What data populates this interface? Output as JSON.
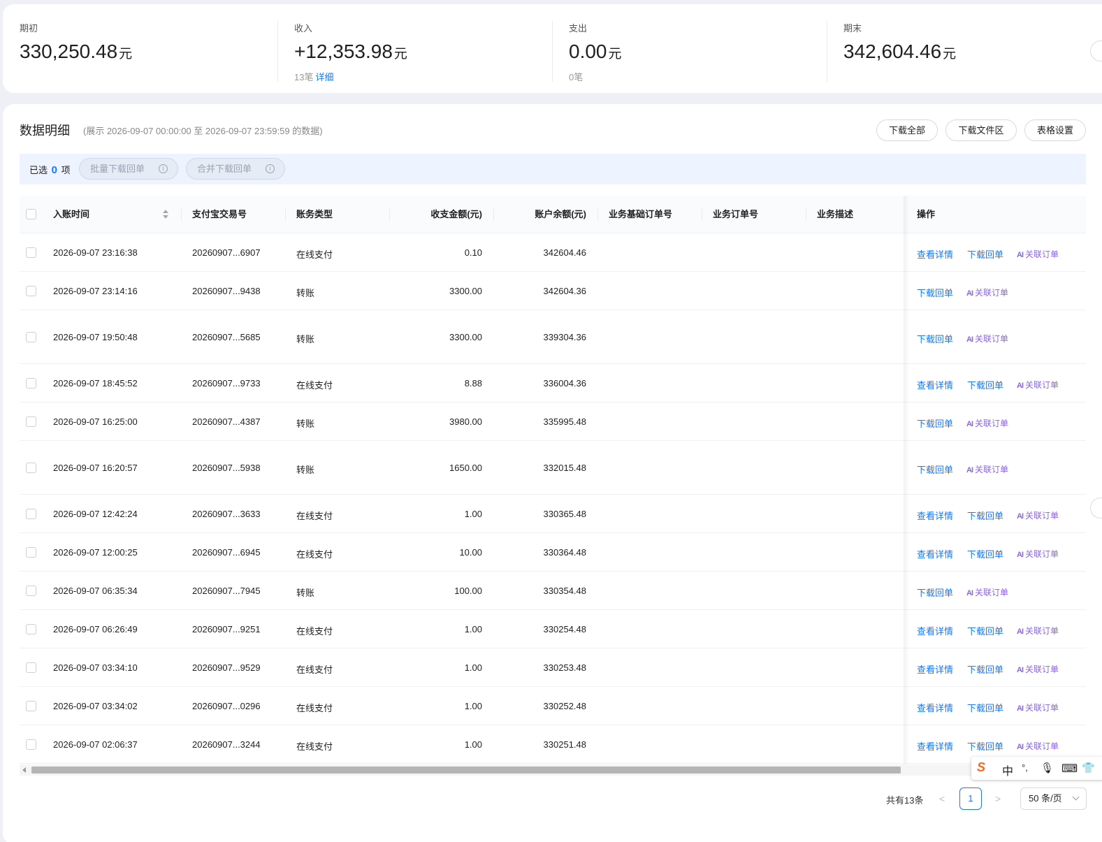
{
  "summary": {
    "opening": {
      "label": "期初",
      "amount": "330,250.48",
      "unit": "元"
    },
    "income": {
      "label": "收入",
      "amount": "+12,353.98",
      "unit": "元",
      "count": "13笔",
      "detail_link": "详细"
    },
    "expense": {
      "label": "支出",
      "amount": "0.00",
      "unit": "元",
      "count": "0笔"
    },
    "closing": {
      "label": "期末",
      "amount": "342,604.46",
      "unit": "元"
    }
  },
  "detail": {
    "title": "数据明细",
    "range": "(展示 2026-09-07 00:00:00 至 2026-09-07 23:59:59 的数据)",
    "buttons": {
      "download_all": "下载全部",
      "download_files": "下载文件区",
      "table_settings": "表格设置"
    }
  },
  "selection": {
    "prefix": "已选",
    "count": "0",
    "suffix": "项",
    "batch_download": "批量下载回单",
    "merge_download": "合并下载回单",
    "info_glyph": "i"
  },
  "table": {
    "columns": {
      "time": "入账时间",
      "trade_no": "支付宝交易号",
      "type": "账务类型",
      "amount": "收支金额(元)",
      "balance": "账户余额(元)",
      "base_order": "业务基础订单号",
      "order": "业务订单号",
      "desc": "业务描述",
      "ops": "操作"
    },
    "actions": {
      "view": "查看详情",
      "download": "下载回单",
      "link_order": "关联订单",
      "ai_icon": "AI"
    },
    "rows": [
      {
        "time": "2026-09-07 23:16:38",
        "trade_no": "20260907...6907",
        "type": "在线支付",
        "amount": "0.10",
        "balance": "342604.46"
      },
      {
        "time": "2026-09-07 23:14:16",
        "trade_no": "20260907...9438",
        "type": "转账",
        "amount": "3300.00",
        "balance": "342604.36"
      },
      {
        "time": "2026-09-07 19:50:48",
        "trade_no": "20260907...5685",
        "type": "转账",
        "amount": "3300.00",
        "balance": "339304.36"
      },
      {
        "time": "2026-09-07 18:45:52",
        "trade_no": "20260907...9733",
        "type": "在线支付",
        "amount": "8.88",
        "balance": "336004.36"
      },
      {
        "time": "2026-09-07 16:25:00",
        "trade_no": "20260907...4387",
        "type": "转账",
        "amount": "3980.00",
        "balance": "335995.48"
      },
      {
        "time": "2026-09-07 16:20:57",
        "trade_no": "20260907...5938",
        "type": "转账",
        "amount": "1650.00",
        "balance": "332015.48"
      },
      {
        "time": "2026-09-07 12:42:24",
        "trade_no": "20260907...3633",
        "type": "在线支付",
        "amount": "1.00",
        "balance": "330365.48"
      },
      {
        "time": "2026-09-07 12:00:25",
        "trade_no": "20260907...6945",
        "type": "在线支付",
        "amount": "10.00",
        "balance": "330364.48"
      },
      {
        "time": "2026-09-07 06:35:34",
        "trade_no": "20260907...7945",
        "type": "转账",
        "amount": "100.00",
        "balance": "330354.48"
      },
      {
        "time": "2026-09-07 06:26:49",
        "trade_no": "20260907...9251",
        "type": "在线支付",
        "amount": "1.00",
        "balance": "330254.48"
      },
      {
        "time": "2026-09-07 03:34:10",
        "trade_no": "20260907...9529",
        "type": "在线支付",
        "amount": "1.00",
        "balance": "330253.48"
      },
      {
        "time": "2026-09-07 03:34:02",
        "trade_no": "20260907...0296",
        "type": "在线支付",
        "amount": "1.00",
        "balance": "330252.48"
      },
      {
        "time": "2026-09-07 02:06:37",
        "trade_no": "20260907...3244",
        "type": "在线支付",
        "amount": "1.00",
        "balance": "330251.48"
      }
    ]
  },
  "pagination": {
    "total": "共有13条",
    "prev": "<",
    "current": "1",
    "next": ">",
    "page_size": "50 条/页"
  },
  "ime_toolbar": {
    "logo": "S",
    "mode": "中",
    "punct": "°,",
    "mic": "🎙",
    "keyboard": "⌨",
    "skin": "👕"
  },
  "colors": {
    "accent": "#1677ff",
    "ai_purple": "#8a63e8",
    "selection_bg": "#edf4ff"
  }
}
